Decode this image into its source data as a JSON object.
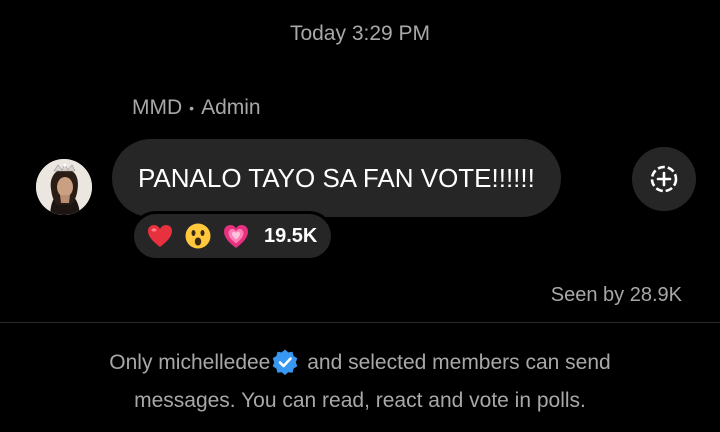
{
  "timestamp": "Today 3:29 PM",
  "message": {
    "sender_name": "MMD",
    "separator": "•",
    "sender_role": "Admin",
    "text": "PANALO TAYO SA FAN VOTE!!!!!!",
    "avatar_icon": "profile-photo",
    "add_reaction_icon": "add-reaction-icon"
  },
  "reactions": {
    "icons": [
      "red-heart-emoji",
      "astonished-face-emoji",
      "growing-heart-emoji"
    ],
    "count": "19.5K"
  },
  "seen": "Seen by 28.9K",
  "notice": {
    "prefix": "Only",
    "username": "michelledee",
    "badge_icon": "verified-badge-icon",
    "suffix_line1": "and selected members can send",
    "line2": "messages. You can read, react and vote in polls."
  },
  "colors": {
    "background": "#000000",
    "bubble": "#262626",
    "secondary_text": "#a8a8a8",
    "verified": "#3897f0"
  }
}
